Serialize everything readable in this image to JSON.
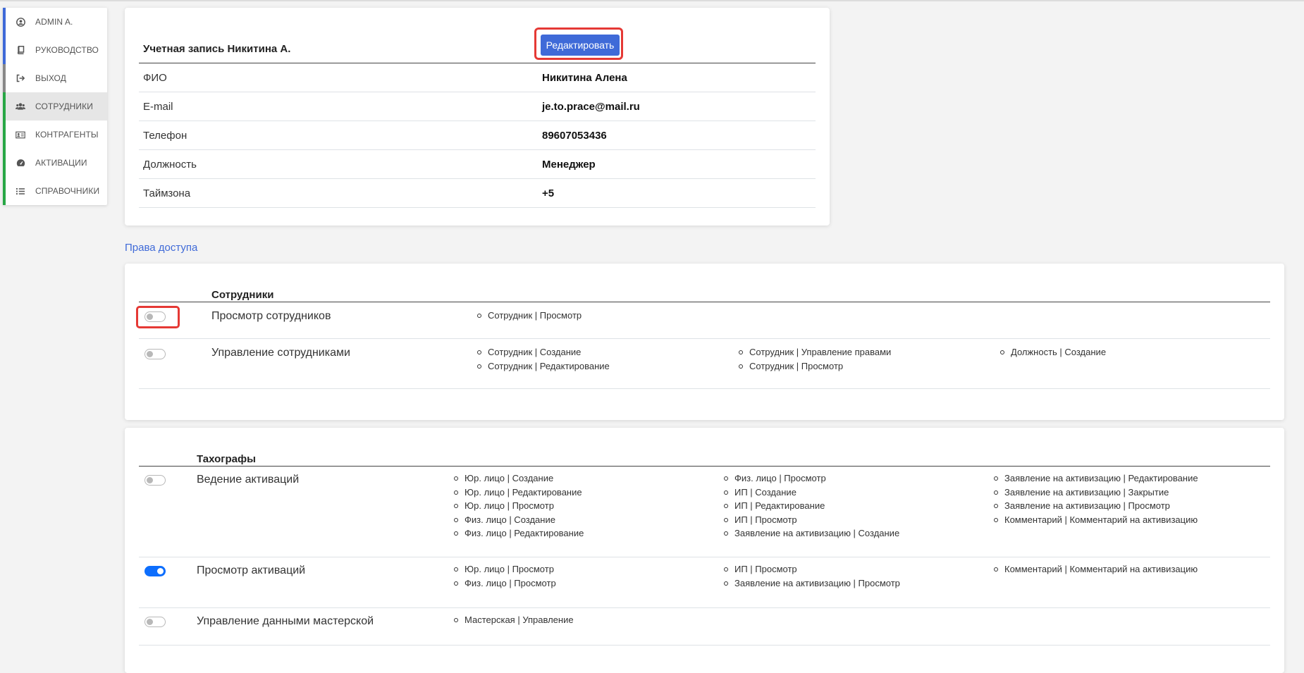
{
  "sidebar": {
    "items": [
      {
        "label": "ADMIN A.",
        "icon": "user-circle-icon",
        "bar_color": "#3f6ad8"
      },
      {
        "label": "РУКОВОДСТВО",
        "icon": "book-icon",
        "bar_color": "#3f6ad8"
      },
      {
        "label": "ВЫХОД",
        "icon": "sign-out-icon",
        "bar_color": "#888888"
      },
      {
        "label": "СОТРУДНИКИ",
        "icon": "users-icon",
        "bar_color": "#28a745"
      },
      {
        "label": "КОНТРАГЕНТЫ",
        "icon": "id-card-icon",
        "bar_color": "#28a745"
      },
      {
        "label": "АКТИВАЦИИ",
        "icon": "tachometer-icon",
        "bar_color": "#28a745"
      },
      {
        "label": "СПРАВОЧНИКИ",
        "icon": "list-icon",
        "bar_color": "#28a745"
      }
    ]
  },
  "account": {
    "title": "Учетная запись Никитина А.",
    "edit_button": "Редактировать",
    "rows": [
      {
        "label": "ФИО",
        "value": "Никитина Алена"
      },
      {
        "label": "E-mail",
        "value": "je.to.prace@mail.ru"
      },
      {
        "label": "Телефон",
        "value": "89607053436"
      },
      {
        "label": "Должность",
        "value": "Менеджер"
      },
      {
        "label": "Таймзона",
        "value": "+5"
      }
    ]
  },
  "access_title": "Права доступа",
  "groups": [
    {
      "title": "Сотрудники",
      "permissions": [
        {
          "label": "Просмотр сотрудников",
          "enabled": false,
          "columns": [
            [
              "Сотрудник | Просмотр"
            ],
            [],
            []
          ]
        },
        {
          "label": "Управление сотрудниками",
          "enabled": false,
          "columns": [
            [
              "Сотрудник | Создание",
              "Сотрудник | Редактирование"
            ],
            [
              "Сотрудник | Управление правами",
              "Сотрудник | Просмотр"
            ],
            [
              "Должность | Создание"
            ]
          ]
        }
      ]
    },
    {
      "title": "Тахографы",
      "permissions": [
        {
          "label": "Ведение активаций",
          "enabled": false,
          "columns": [
            [
              "Юр. лицо | Создание",
              "Юр. лицо | Редактирование",
              "Юр. лицо | Просмотр",
              "Физ. лицо | Создание",
              "Физ. лицо | Редактирование"
            ],
            [
              "Физ. лицо | Просмотр",
              "ИП | Создание",
              "ИП | Редактирование",
              "ИП | Просмотр",
              "Заявление на активизацию | Создание"
            ],
            [
              "Заявление на активизацию | Редактирование",
              "Заявление на активизацию | Закрытие",
              "Заявление на активизацию | Просмотр",
              "Комментарий | Комментарий на активизацию"
            ]
          ]
        },
        {
          "label": "Просмотр активаций",
          "enabled": true,
          "columns": [
            [
              "Юр. лицо | Просмотр",
              "Физ. лицо | Просмотр"
            ],
            [
              "ИП | Просмотр",
              "Заявление на активизацию | Просмотр"
            ],
            [
              "Комментарий | Комментарий на активизацию"
            ]
          ]
        },
        {
          "label": "Управление данными мастерской",
          "enabled": false,
          "columns": [
            [
              "Мастерская | Управление"
            ],
            [],
            []
          ]
        }
      ]
    }
  ]
}
